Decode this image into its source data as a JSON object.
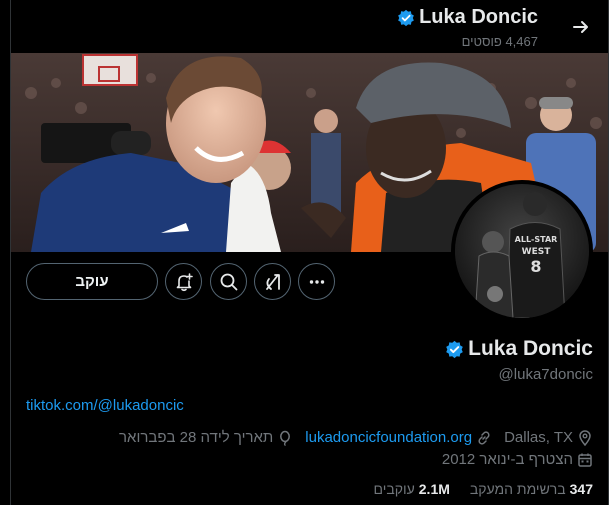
{
  "header": {
    "name": "Luka Doncic",
    "posts_count": "4,467 פוסטים"
  },
  "actions": {
    "follow_label": "עוקב"
  },
  "profile": {
    "name": "Luka Doncic",
    "handle": "@luka7doncic",
    "bio_link": "tiktok.com/@lukadoncic",
    "location": "Dallas, TX",
    "website": "lukadoncicfoundation.org",
    "birthday": "תאריך לידה 28 בפברואר",
    "joined": "הצטרף ב-ינואר 2012"
  },
  "stats": {
    "following_count": "347",
    "following_label": "ברשימת המעקב",
    "followers_count": "2.1M",
    "followers_label": "עוקבים"
  },
  "avatar_text": {
    "jersey_line1": "ALL-STAR",
    "jersey_line2": "WEST"
  },
  "colors": {
    "background": "#000000",
    "text_primary": "#e7e9ea",
    "text_secondary": "#71767b",
    "accent_link": "#1d9bf0",
    "verified_badge": "#1d9bf0",
    "button_border": "#536471"
  },
  "icons": [
    "arrow-right-icon",
    "verified-badge-icon",
    "notification-bell-plus-icon",
    "search-icon",
    "grok-icon",
    "more-dots-icon",
    "location-icon",
    "link-icon",
    "balloon-icon",
    "calendar-icon"
  ]
}
